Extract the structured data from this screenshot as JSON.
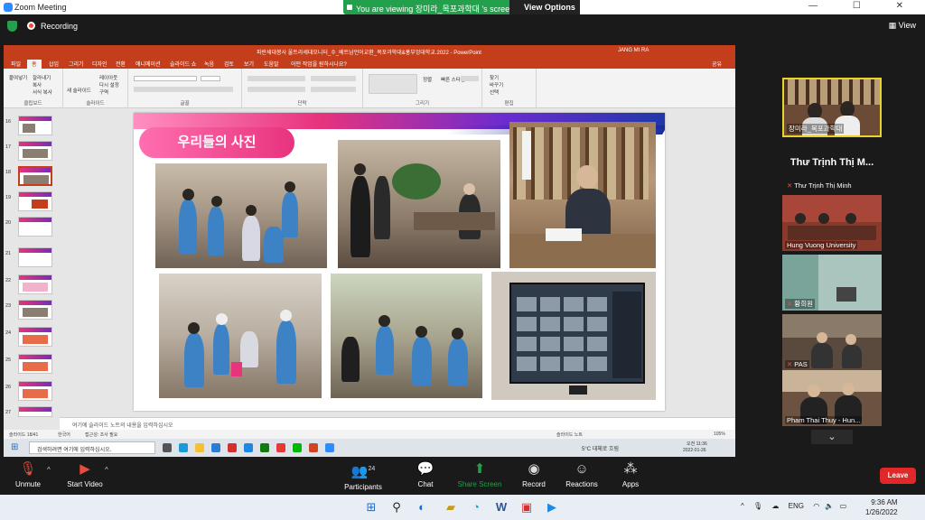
{
  "window": {
    "title": "Zoom Meeting",
    "controls": "—  ☐  ✕"
  },
  "banner": {
    "message": "You are viewing 장미라_목포과학대 's screen",
    "view_options": "View Options ▾"
  },
  "zoom_top": {
    "recording": "Recording",
    "view": "View"
  },
  "ppt": {
    "title": "파란세대봉사 울트라세대모니터_수_베트남언어교환_목포과학대&훙부엉대학교.2022 - PowerPoint",
    "user": "JANG MI RA",
    "tabs": [
      "파일",
      "홈",
      "삽입",
      "그리기",
      "디자인",
      "전환",
      "애니메이션",
      "슬라이드 쇼",
      "녹음",
      "검토",
      "보기",
      "도움말",
      "어떤 작업을 원하시나요?"
    ],
    "share_label": "공유",
    "ribbon_groups": [
      "클립보드",
      "슬라이드",
      "글꼴",
      "단락",
      "그리기",
      "편집"
    ],
    "ribbon_items": {
      "paste": "붙여넣기",
      "new_slide": "새 슬라이드",
      "layout": "레이아웃",
      "reset": "다시 설정",
      "section": "구역",
      "cut": "잘라내기",
      "copy": "복사",
      "format": "서식 복사",
      "find": "찾기",
      "replace": "바꾸기",
      "select": "선택",
      "arrange": "정렬",
      "quick_styles": "빠른 스타일"
    },
    "slide_numbers": [
      "16",
      "17",
      "18",
      "19",
      "20",
      "21",
      "22",
      "23",
      "24",
      "25",
      "26",
      "27"
    ],
    "selected_slide": "18",
    "slide_title": "우리들의 사진",
    "notes_placeholder": "여기에 슬라이드 노트의 내용을 입력하십시오",
    "status": {
      "slide_info": "슬라이드 18/41",
      "lang": "한국어",
      "access": "접근성: 조사 필요",
      "notes": "슬라이드 노트",
      "zoom": "105%"
    }
  },
  "inner_taskbar": {
    "search": "검색하려면 여기에 입력하십시오.",
    "weather": "5°C 대체로 흐림",
    "time": "오전 11:36",
    "date": "2022-01-26"
  },
  "gallery": {
    "big_name": "Thư Trịnh Thị M...",
    "tiles": [
      {
        "name": "장미라_목포과학대",
        "muted": false
      },
      {
        "name": "Thư Trịnh Thị Minh",
        "muted": true
      },
      {
        "name": "Hung Vuong University",
        "muted": false
      },
      {
        "name": "황희원",
        "muted": true
      },
      {
        "name": "PAS",
        "muted": true
      },
      {
        "name": "Pham Thai Thuy - Hun...",
        "muted": false
      }
    ],
    "chevron": "⌄"
  },
  "toolbar": {
    "unmute": "Unmute",
    "start_video": "Start Video",
    "participants": "Participants",
    "participants_count": "24",
    "chat": "Chat",
    "share": "Share Screen",
    "record": "Record",
    "reactions": "Reactions",
    "apps": "Apps",
    "leave": "Leave"
  },
  "taskbar": {
    "lang": "ENG",
    "time": "9:36 AM",
    "date": "1/26/2022"
  },
  "colors": {
    "zoom_green": "#23a04b",
    "ppt_red": "#c43e1c",
    "leave_red": "#e02828",
    "slide_pink": "#e8337d"
  }
}
